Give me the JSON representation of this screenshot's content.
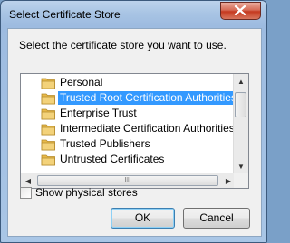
{
  "window": {
    "title": "Select Certificate Store"
  },
  "prompt": "Select the certificate store you want to use.",
  "stores": [
    {
      "label": "Personal",
      "selected": false
    },
    {
      "label": "Trusted Root Certification Authorities",
      "selected": true
    },
    {
      "label": "Enterprise Trust",
      "selected": false
    },
    {
      "label": "Intermediate Certification Authorities",
      "selected": false
    },
    {
      "label": "Trusted Publishers",
      "selected": false
    },
    {
      "label": "Untrusted Certificates",
      "selected": false
    }
  ],
  "scrollbar": {
    "up": "▲",
    "down": "▼",
    "left": "◀",
    "right": "▶",
    "grip": "III"
  },
  "show_physical": {
    "label": "Show physical stores",
    "checked": false
  },
  "buttons": {
    "ok": "OK",
    "cancel": "Cancel"
  },
  "colors": {
    "selection": "#3399ff",
    "folder": "#f3d27a"
  }
}
